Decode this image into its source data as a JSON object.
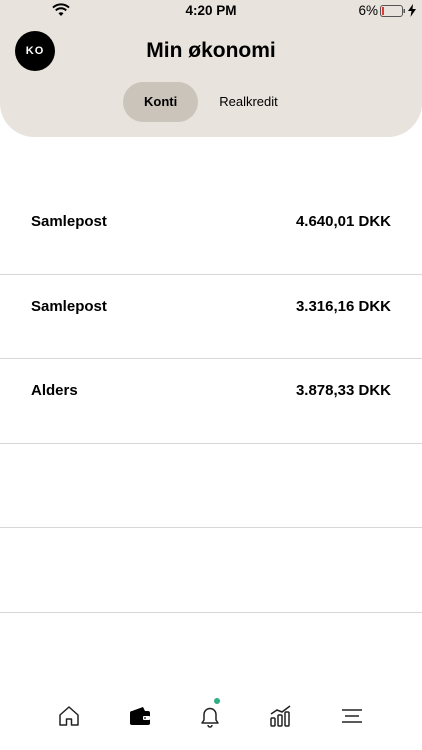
{
  "status_bar": {
    "time": "4:20 PM",
    "battery_percent": "6%",
    "icons": [
      "wifi-icon",
      "battery-icon",
      "charging-icon"
    ]
  },
  "header": {
    "avatar_initials": "KO",
    "title": "Min økonomi"
  },
  "tabs": [
    {
      "label": "Konti",
      "active": true
    },
    {
      "label": "Realkredit",
      "active": false
    }
  ],
  "accounts": [
    {
      "name": "Samlepost",
      "amount": "4.640,01 DKK"
    },
    {
      "name": "Samlepost",
      "amount": "3.316,16 DKK"
    },
    {
      "name": "Alders",
      "amount": "3.878,33 DKK"
    }
  ],
  "bottom_nav": {
    "items": [
      "home-icon",
      "wallet-icon",
      "bell-icon",
      "chart-icon",
      "menu-icon"
    ],
    "active": "wallet-icon",
    "notification_dot_color": "#2fae86"
  },
  "colors": {
    "header_bg": "#e8e3dc",
    "active_tab_bg": "#cac4bb",
    "battery_low": "#e03a3a"
  }
}
